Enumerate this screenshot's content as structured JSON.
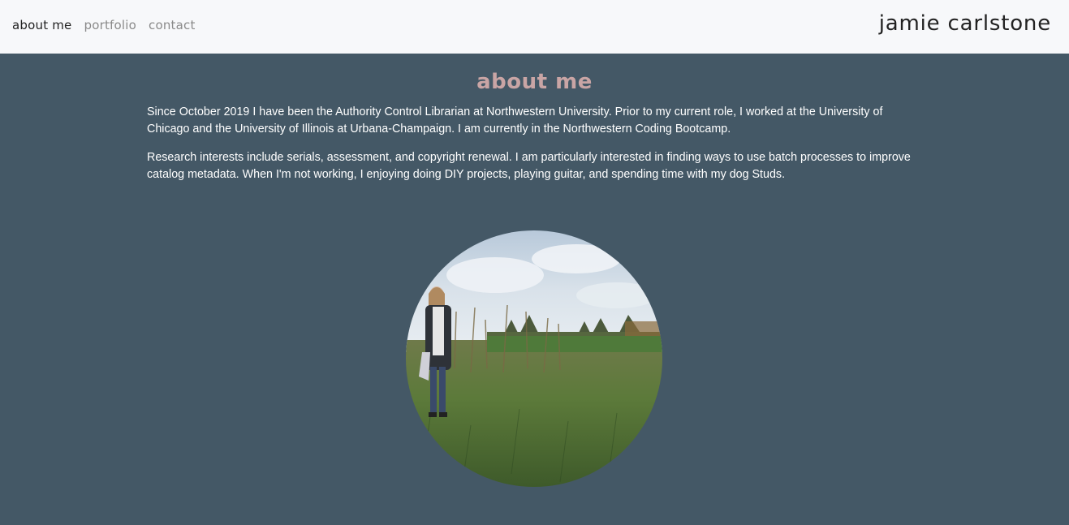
{
  "nav": {
    "links": [
      {
        "label": "about me",
        "active": true
      },
      {
        "label": "portfolio",
        "active": false
      },
      {
        "label": "contact",
        "active": false
      }
    ],
    "brand": "jamie carlstone"
  },
  "main": {
    "title": "about me",
    "paragraphs": [
      "Since October 2019 I have been the Authority Control Librarian at Northwestern University. Prior to my current role, I worked at the University of Chicago and the University of Illinois at Urbana-Champaign. I am currently in the Northwestern Coding Bootcamp.",
      "Research interests include serials, assessment, and copyright renewal. I am particularly interested in finding ways to use batch processes to improve catalog metadata. When I'm not working, I enjoying doing DIY projects, playing guitar, and spending time with my dog Studs."
    ]
  },
  "colors": {
    "background": "#445866",
    "navbar": "#f7f8fa",
    "title": "#c9a5a5",
    "text": "#ffffff"
  }
}
